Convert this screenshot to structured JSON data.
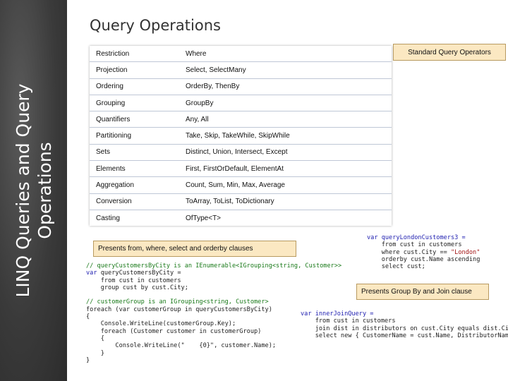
{
  "sidebar": {
    "line1": "LINQ Queries and Query",
    "line2": "Operations"
  },
  "title": "Query Operations",
  "table": {
    "rows": [
      {
        "category": "Restriction",
        "operators": "Where"
      },
      {
        "category": "Projection",
        "operators": "Select, SelectMany"
      },
      {
        "category": "Ordering",
        "operators": "OrderBy, ThenBy"
      },
      {
        "category": "Grouping",
        "operators": "GroupBy"
      },
      {
        "category": "Quantifiers",
        "operators": "Any, All"
      },
      {
        "category": "Partitioning",
        "operators": "Take, Skip, TakeWhile, SkipWhile"
      },
      {
        "category": "Sets",
        "operators": "Distinct, Union, Intersect, Except"
      },
      {
        "category": "Elements",
        "operators": "First, FirstOrDefault, ElementAt"
      },
      {
        "category": "Aggregation",
        "operators": "Count, Sum, Min, Max, Average"
      },
      {
        "category": "Conversion",
        "operators": "ToArray, ToList, ToDictionary"
      },
      {
        "category": "Casting",
        "operators": "OfType<T>"
      }
    ]
  },
  "callouts": {
    "standard": "Standard Query Operators",
    "presents_from": "Presents from, where, select and orderby clauses",
    "presents_group": "Presents  Group By and Join clause"
  },
  "code_london": {
    "l1": "var queryLondonCustomers3 =",
    "l2": "    from cust in customers",
    "l3a": "    where cust.City == ",
    "l3b": "\"London\"",
    "l4": "    orderby cust.Name ascending",
    "l5": "    select cust;"
  },
  "code_group": {
    "l1": "// queryCustomersByCity is an IEnumerable<IGrouping<string, Customer>>",
    "l2a": "var",
    "l2b": " queryCustomersByCity =",
    "l3": "    from cust in customers",
    "l4": "    group cust by cust.City;",
    "l5": "",
    "l6": "// customerGroup is an IGrouping<string, Customer>",
    "l7": "foreach (var customerGroup in queryCustomersByCity)",
    "l8": "{",
    "l9": "    Console.WriteLine(customerGroup.Key);",
    "l10": "    foreach (Customer customer in customerGroup)",
    "l11": "    {",
    "l12": "        Console.WriteLine(\"    {0}\", customer.Name);",
    "l13": "    }",
    "l14": "}"
  },
  "code_join": {
    "l1": "var innerJoinQuery =",
    "l2": "    from cust in customers",
    "l3": "    join dist in distributors on cust.City equals dist.City",
    "l4": "    select new { CustomerName = cust.Name, DistributorName = dist.Name };"
  }
}
